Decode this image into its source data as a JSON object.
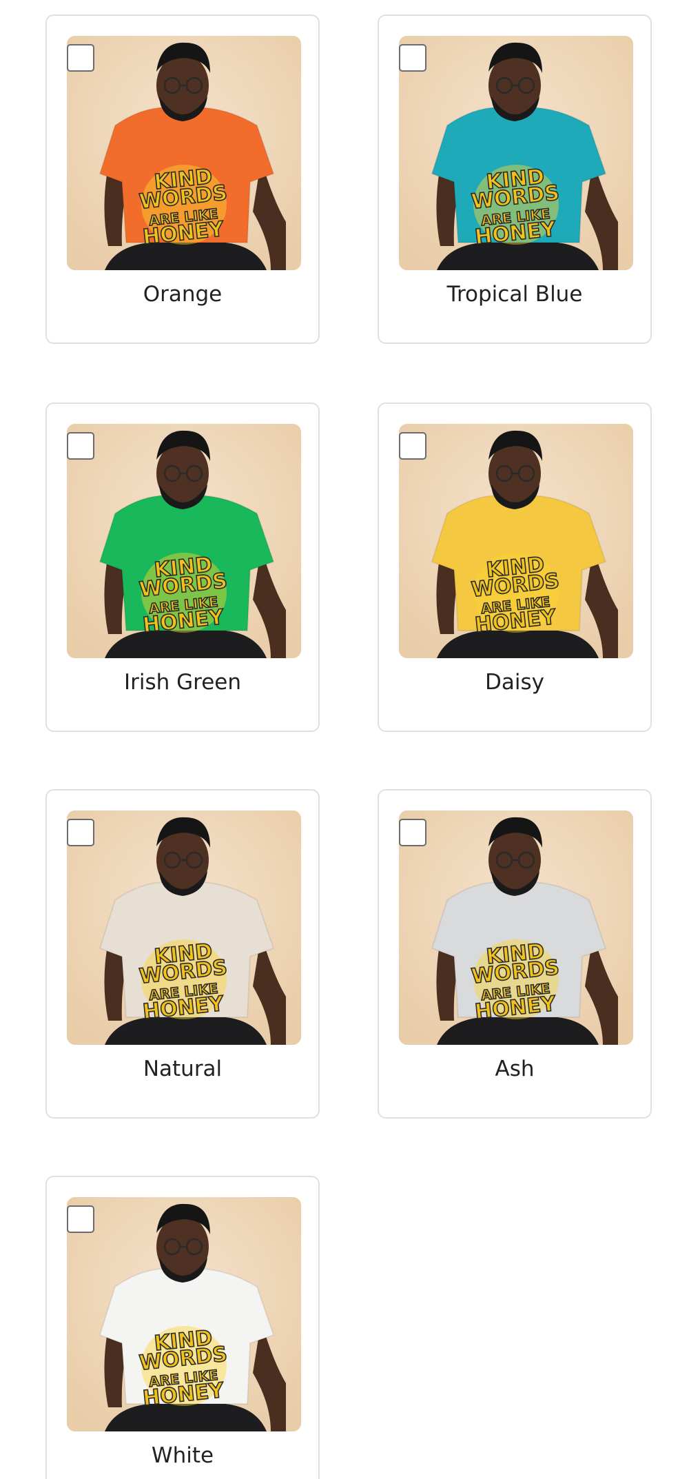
{
  "colors": [
    {
      "label": "Orange",
      "shirt": "#f26d2c"
    },
    {
      "label": "Tropical Blue",
      "shirt": "#1eaab9"
    },
    {
      "label": "Irish Green",
      "shirt": "#19b85a"
    },
    {
      "label": "Daisy",
      "shirt": "#f5c842"
    },
    {
      "label": "Natural",
      "shirt": "#e7dfd3"
    },
    {
      "label": "Ash",
      "shirt": "#d9dadc"
    },
    {
      "label": "White",
      "shirt": "#f4f4f2"
    }
  ],
  "design_text": [
    "KIND",
    "WORDS",
    "ARE LIKE",
    "HONEY"
  ],
  "checkbox_icon": "empty-checkbox"
}
